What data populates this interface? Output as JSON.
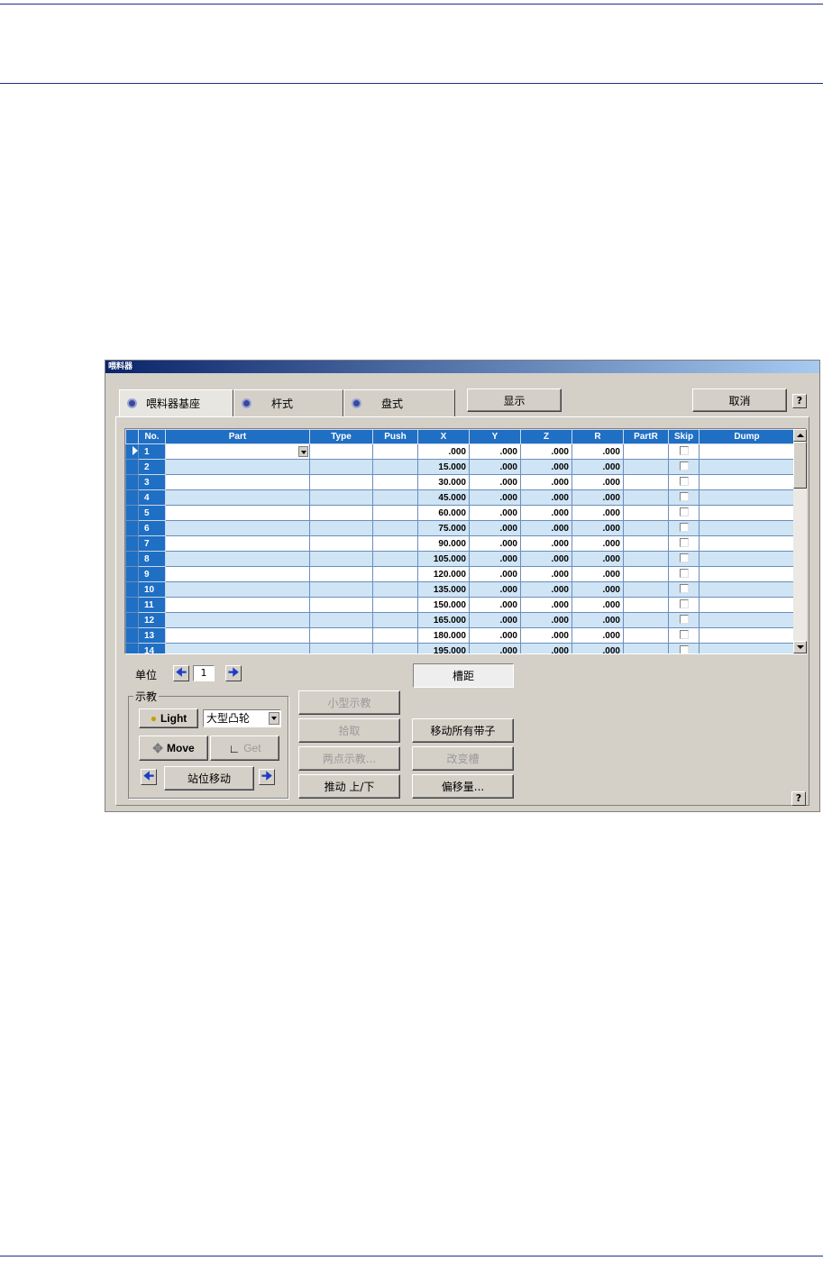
{
  "dialog": {
    "title": "喂料器"
  },
  "tabs": [
    {
      "label": "喂料器基座",
      "active": true
    },
    {
      "label": "杆式",
      "active": false
    },
    {
      "label": "盘式",
      "active": false
    }
  ],
  "buttons": {
    "display": "显示",
    "cancel": "取消",
    "help": "?",
    "light": "Light",
    "move": "Move",
    "get": "Get",
    "station_move": "站位移动",
    "small_teach": "小型示教",
    "pick": "拾取",
    "two_point_teach": "两点示教...",
    "push_updown": "推动 上/下",
    "move_all_tapes": "移动所有带子",
    "change_slot": "改变槽",
    "offset": "偏移量..."
  },
  "grid": {
    "columns": [
      "No.",
      "Part",
      "Type",
      "Push",
      "X",
      "Y",
      "Z",
      "R",
      "PartR",
      "Skip",
      "Dump"
    ],
    "rows": [
      {
        "no": "1",
        "x": ".000",
        "y": ".000",
        "z": ".000",
        "r": ".000"
      },
      {
        "no": "2",
        "x": "15.000",
        "y": ".000",
        "z": ".000",
        "r": ".000"
      },
      {
        "no": "3",
        "x": "30.000",
        "y": ".000",
        "z": ".000",
        "r": ".000"
      },
      {
        "no": "4",
        "x": "45.000",
        "y": ".000",
        "z": ".000",
        "r": ".000"
      },
      {
        "no": "5",
        "x": "60.000",
        "y": ".000",
        "z": ".000",
        "r": ".000"
      },
      {
        "no": "6",
        "x": "75.000",
        "y": ".000",
        "z": ".000",
        "r": ".000"
      },
      {
        "no": "7",
        "x": "90.000",
        "y": ".000",
        "z": ".000",
        "r": ".000"
      },
      {
        "no": "8",
        "x": "105.000",
        "y": ".000",
        "z": ".000",
        "r": ".000"
      },
      {
        "no": "9",
        "x": "120.000",
        "y": ".000",
        "z": ".000",
        "r": ".000"
      },
      {
        "no": "10",
        "x": "135.000",
        "y": ".000",
        "z": ".000",
        "r": ".000"
      },
      {
        "no": "11",
        "x": "150.000",
        "y": ".000",
        "z": ".000",
        "r": ".000"
      },
      {
        "no": "12",
        "x": "165.000",
        "y": ".000",
        "z": ".000",
        "r": ".000"
      },
      {
        "no": "13",
        "x": "180.000",
        "y": ".000",
        "z": ".000",
        "r": ".000"
      },
      {
        "no": "14",
        "x": "195.000",
        "y": ".000",
        "z": ".000",
        "r": ".000"
      }
    ]
  },
  "unit": {
    "label": "单位",
    "value": "1"
  },
  "slot_pitch_label": "槽距",
  "teach_group": {
    "title": "示教",
    "combo_value": "大型凸轮"
  },
  "colors": {
    "header_blue": "#1f6fc4",
    "row_alt": "#cfe4f4",
    "dialog_bg": "#d4d0c8"
  }
}
